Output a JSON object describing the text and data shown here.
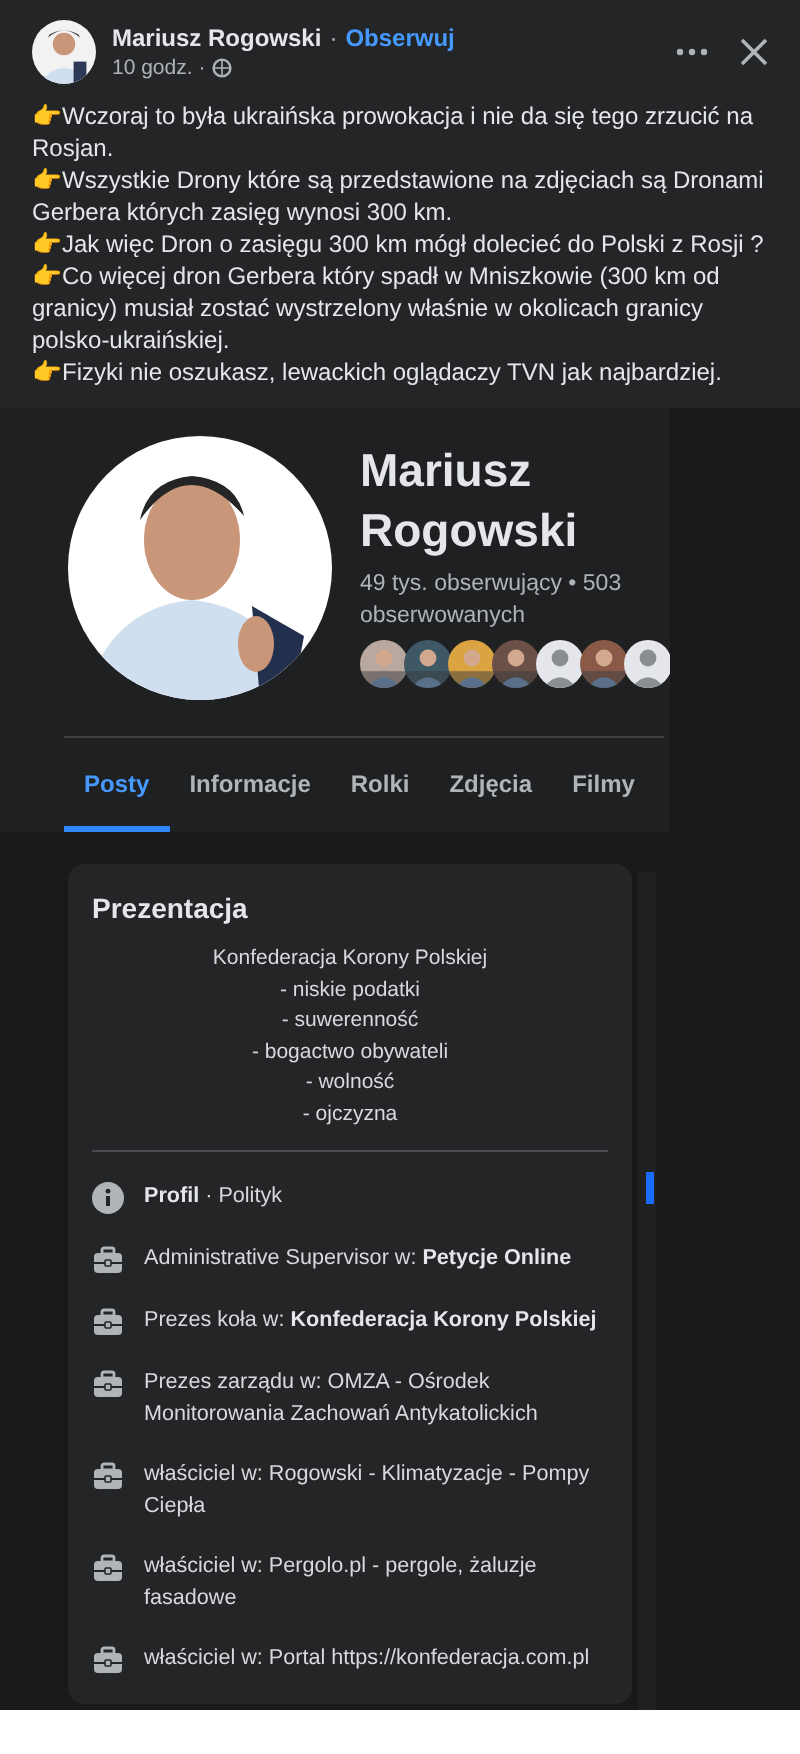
{
  "post": {
    "author": "Mariusz Rogowski",
    "separator": "·",
    "follow": "Obserwuj",
    "time": "10 godz. ·",
    "paragraphs": [
      "👉Wczoraj to była ukraińska prowokacja i nie da się tego zrzucić na Rosjan.",
      "👉Wszystkie Drony które są przedstawione na zdjęciach są Dronami Gerbera których zasięg wynosi 300 km.",
      "👉Jak więc Dron o zasięgu 300 km mógł dolecieć do Polski z Rosji ?",
      "👉Co więcej dron Gerbera który spadł w Mniszkowie (300 km od granicy) musiał zostać wystrzelony właśnie w okolicach granicy polsko-ukraińskiej.",
      "👉Fizyki nie oszukasz, lewackich oglądaczy TVN jak najbardziej."
    ]
  },
  "profile": {
    "name": "Mariusz Rogowski",
    "stats": "49 tys. obserwujący • 503 obserwowanych",
    "followers": [
      {
        "kind": "picture",
        "color": "#b8a8a0"
      },
      {
        "kind": "picture",
        "color": "#3f5866"
      },
      {
        "kind": "picture",
        "color": "#d9a441"
      },
      {
        "kind": "picture",
        "color": "#6b5048"
      },
      {
        "kind": "default",
        "color": "#e4e6eb"
      },
      {
        "kind": "picture",
        "color": "#8a5a48"
      },
      {
        "kind": "default",
        "color": "#e4e6eb"
      }
    ]
  },
  "tabs": [
    {
      "label": "Posty",
      "selected": true
    },
    {
      "label": "Informacje",
      "selected": false
    },
    {
      "label": "Rolki",
      "selected": false
    },
    {
      "label": "Zdjęcia",
      "selected": false
    },
    {
      "label": "Filmy",
      "selected": false
    }
  ],
  "intro": {
    "title": "Prezentacja",
    "bio": [
      "Konfederacja Korony Polskiej",
      "- niskie podatki",
      "- suwerenność",
      "- bogactwo obywateli",
      "- wolność",
      "- ojczyzna"
    ],
    "details": [
      {
        "kind": "info",
        "text": "**Profil** · Polityk"
      },
      {
        "kind": "work",
        "text": "Administrative Supervisor w: **Petycje Online**"
      },
      {
        "kind": "work",
        "text": "Prezes koła w: **Konfederacja Korony Polskiej**"
      },
      {
        "kind": "work",
        "text": "Prezes zarządu w: OMZA - Ośrodek Monitorowania Zachowań Antykatolickich"
      },
      {
        "kind": "work",
        "text": "właściciel w: Rogowski - Klimatyzacje - Pompy Ciepła"
      },
      {
        "kind": "work",
        "text": "właściciel w: Pergolo.pl - pergole, żaluzje fasadowe"
      },
      {
        "kind": "work",
        "text": "właściciel w: Portal https://konfederacja.com.pl"
      }
    ]
  }
}
